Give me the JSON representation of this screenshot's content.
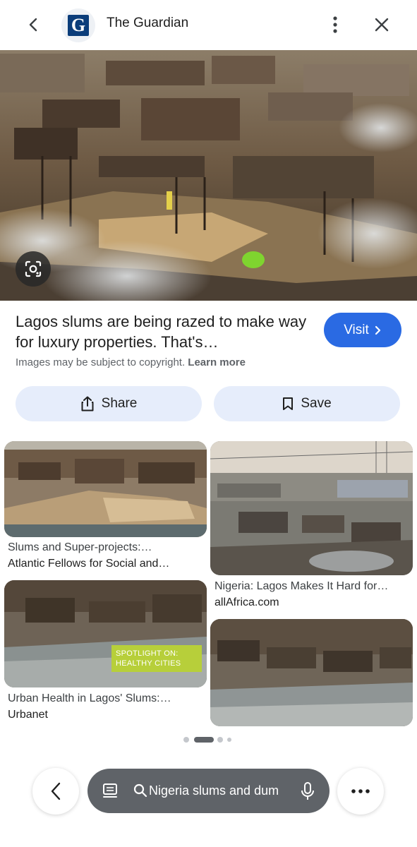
{
  "header": {
    "site_title": "The Guardian",
    "logo_letter": "G",
    "icons": {
      "back": "back-arrow-icon",
      "more": "more-vert-icon",
      "close": "close-icon"
    }
  },
  "hero": {
    "lens_icon": "lens-icon"
  },
  "result": {
    "headline": "Lagos slums are being razed to make way for luxury properties. That's…",
    "visit_label": "Visit",
    "copyright_text": "Images may be subject to copyright.",
    "learn_more": "Learn more",
    "share_label": "Share",
    "save_label": "Save"
  },
  "related": [
    {
      "title": "Slums and Super-projects:…",
      "source": "Atlantic Fellows for Social and…"
    },
    {
      "title": "Nigeria: Lagos Makes It Hard for…",
      "source": "allAfrica.com"
    },
    {
      "title": "Urban Health in Lagos' Slums:…",
      "source": "Urbanet",
      "overlay_text_1": "SPOTLIGHT ON:",
      "overlay_text_2": "HEALTHY CITIES"
    },
    {
      "title": "",
      "source": ""
    }
  ],
  "pagination": {
    "pages": 4,
    "active": 1
  },
  "bottom_bar": {
    "query": "Nigeria slums and dum",
    "icons": {
      "back": "back-arrow-icon",
      "tabs": "tabs-icon",
      "search": "search-icon",
      "mic": "mic-icon",
      "more": "more-horiz-icon"
    }
  },
  "colors": {
    "accent": "#2a6ae3",
    "action_bg": "#e6edfb",
    "pill_bg": "#5f6368",
    "overlay_green": "#b7cf3a"
  }
}
